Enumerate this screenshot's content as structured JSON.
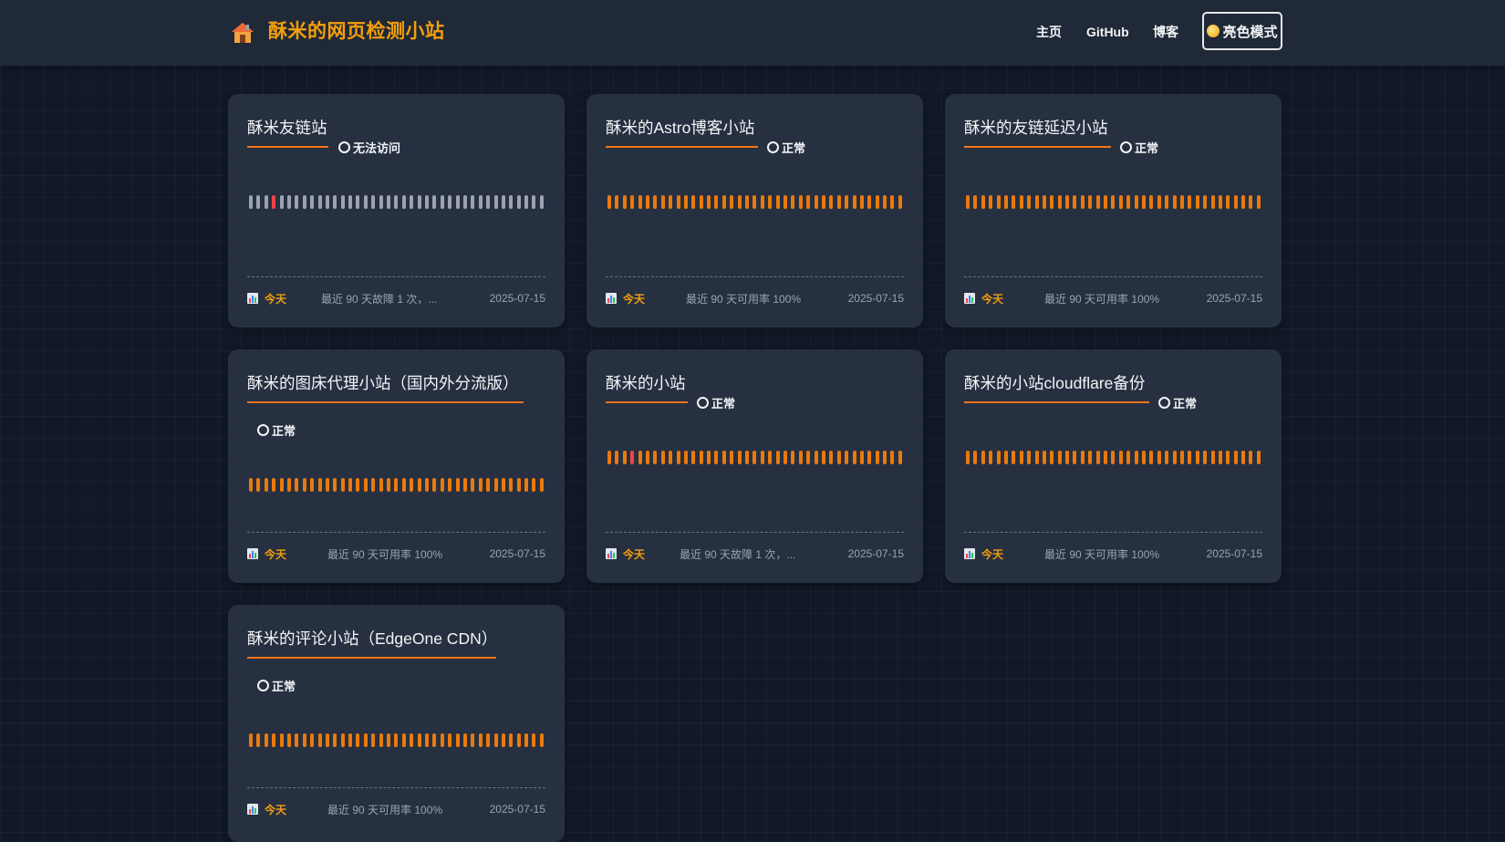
{
  "header": {
    "logo_icon": "house-icon",
    "title": "酥米的网页检测小站",
    "nav": [
      {
        "label": "主页"
      },
      {
        "label": "GitHub"
      },
      {
        "label": "博客"
      }
    ],
    "theme_toggle": {
      "label": "亮色模式",
      "icon": "sun-icon"
    }
  },
  "colors": {
    "accent": "#f59e0b",
    "bar_up": "#ea7a0d",
    "bar_down": "#ef4444",
    "card_bg": "#263041",
    "page_bg": "#111827"
  },
  "monitors": [
    {
      "name": "酥米友链站",
      "status": "无法访问",
      "bars": "gggrggggggggggggggggggggggggggggggggggg",
      "footer": {
        "today": "今天",
        "summary": "最近 90 天故障 1 次，...",
        "date": "2025-07-15"
      }
    },
    {
      "name": "酥米的Astro博客小站",
      "status": "正常",
      "bars": "ooooooooooooooooooooooooooooooooooooooo",
      "footer": {
        "today": "今天",
        "summary": "最近 90 天可用率 100%",
        "date": "2025-07-15"
      }
    },
    {
      "name": "酥米的友链延迟小站",
      "status": "正常",
      "bars": "ooooooooooooooooooooooooooooooooooooooo",
      "footer": {
        "today": "今天",
        "summary": "最近 90 天可用率 100%",
        "date": "2025-07-15"
      }
    },
    {
      "name": "酥米的图床代理小站（国内外分流版）",
      "status": "正常",
      "bars": "ooooooooooooooooooooooooooooooooooooooo",
      "footer": {
        "today": "今天",
        "summary": "最近 90 天可用率 100%",
        "date": "2025-07-15"
      }
    },
    {
      "name": "酥米的小站",
      "status": "正常",
      "bars": "ooorooooooooooooooooooooooooooooooooooo",
      "footer": {
        "today": "今天",
        "summary": "最近 90 天故障 1 次，...",
        "date": "2025-07-15"
      }
    },
    {
      "name": "酥米的小站cloudflare备份",
      "status": "正常",
      "bars": "ooooooooooooooooooooooooooooooooooooooo",
      "footer": {
        "today": "今天",
        "summary": "最近 90 天可用率 100%",
        "date": "2025-07-15"
      }
    },
    {
      "name": "酥米的评论小站（EdgeOne CDN）",
      "status": "正常",
      "bars": "ooooooooooooooooooooooooooooooooooooooo",
      "footer": {
        "today": "今天",
        "summary": "最近 90 天可用率 100%",
        "date": "2025-07-15"
      }
    }
  ]
}
